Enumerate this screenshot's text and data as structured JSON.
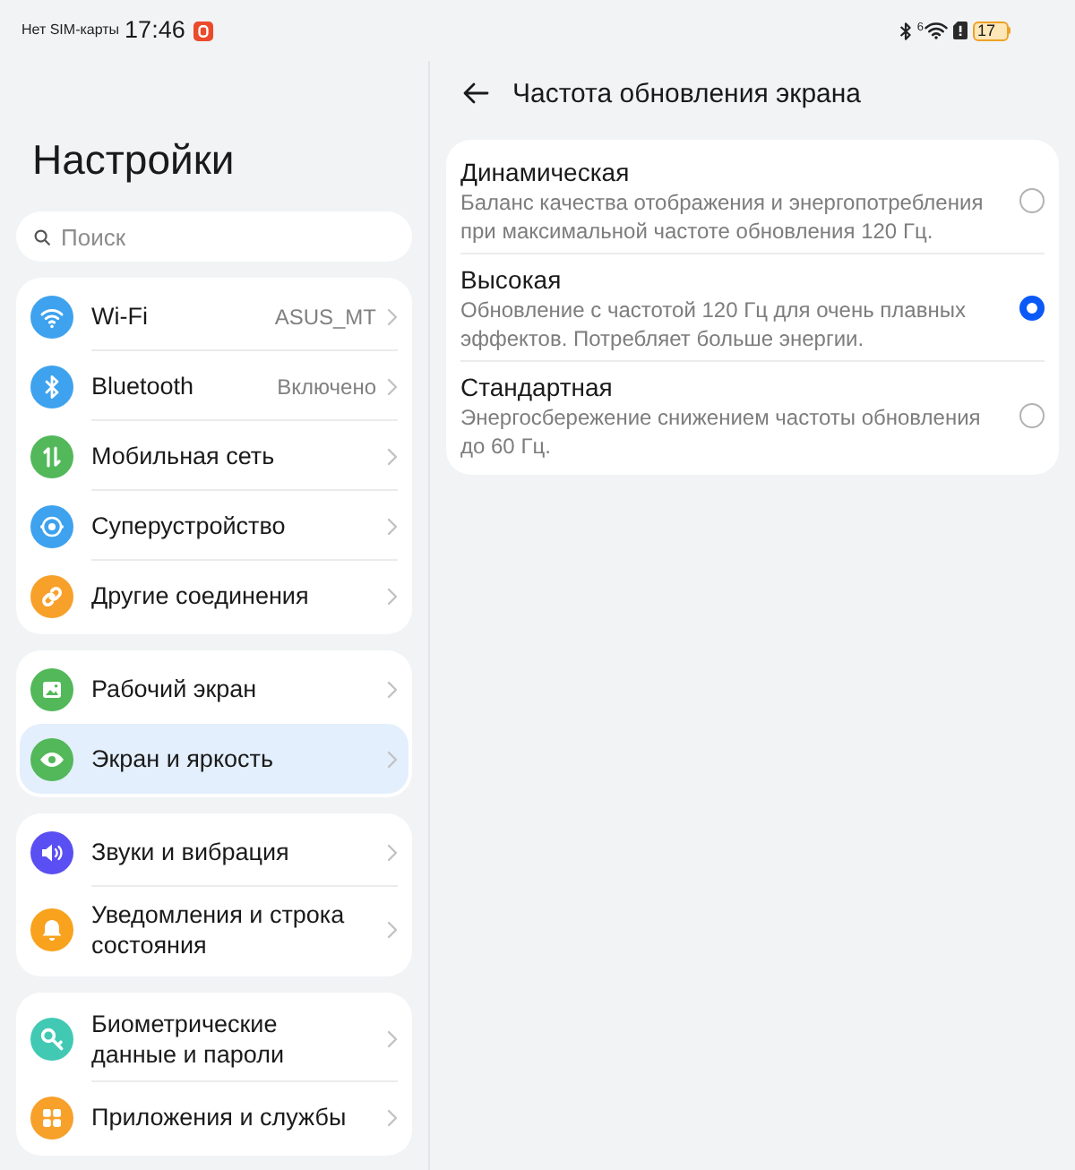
{
  "status_bar": {
    "carrier": "Нет SIM-карты",
    "time": "17:46",
    "wifi_label": "6",
    "battery": "17"
  },
  "sidebar": {
    "title": "Настройки",
    "search": {
      "placeholder": "Поиск"
    },
    "groups": [
      {
        "items": [
          {
            "label": "Wi-Fi",
            "value": "ASUS_MT",
            "selected": false
          },
          {
            "label": "Bluetooth",
            "value": "Включено",
            "selected": false
          },
          {
            "label": "Мобильная сеть",
            "selected": false
          },
          {
            "label": "Суперустройство",
            "selected": false
          },
          {
            "label": "Другие соединения",
            "selected": false
          }
        ]
      },
      {
        "items": [
          {
            "label": "Рабочий экран",
            "selected": false
          },
          {
            "label": "Экран и яркость",
            "selected": true
          }
        ]
      },
      {
        "items": [
          {
            "label": "Звуки и вибрация",
            "selected": false
          },
          {
            "label": "Уведомления и строка состояния",
            "selected": false
          }
        ]
      },
      {
        "items": [
          {
            "label": "Биометрические данные и пароли",
            "selected": false
          },
          {
            "label": "Приложения и службы",
            "selected": false
          }
        ]
      }
    ]
  },
  "detail": {
    "title": "Частота обновления экрана",
    "options": [
      {
        "title": "Динамическая",
        "description": "Баланс качества отображения и энергопотребления при максимальной частоте обновления 120 Гц.",
        "selected": false
      },
      {
        "title": "Высокая",
        "description": "Обновление с частотой 120 Гц для очень плавных эффектов. Потребляет больше энергии.",
        "selected": true
      },
      {
        "title": "Стандартная",
        "description": "Энергосбережение снижением частоты обновления до 60 Гц.",
        "selected": false
      }
    ]
  }
}
